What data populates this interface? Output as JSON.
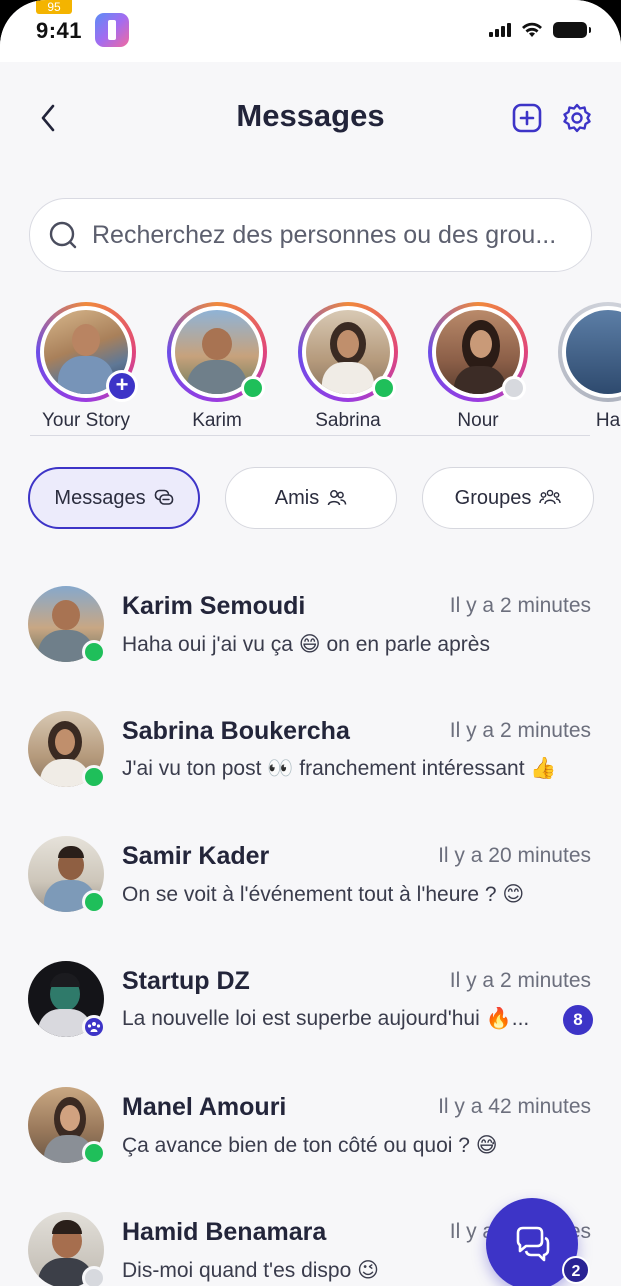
{
  "status_bar": {
    "battery_tag": "95",
    "time": "9:41"
  },
  "header": {
    "title": "Messages"
  },
  "search": {
    "placeholder": "Recherchez des personnes ou des grou..."
  },
  "stories": [
    {
      "name": "Your Story",
      "status": "add"
    },
    {
      "name": "Karim",
      "status": "online"
    },
    {
      "name": "Sabrina",
      "status": "online"
    },
    {
      "name": "Nour",
      "status": "offline"
    },
    {
      "name": "Ha",
      "status": "none"
    }
  ],
  "tabs": [
    {
      "label": "Messages",
      "icon": "chat-bubbles-icon",
      "active": true
    },
    {
      "label": "Amis",
      "icon": "users-icon",
      "active": false
    },
    {
      "label": "Groupes",
      "icon": "group-icon",
      "active": false
    }
  ],
  "conversations": [
    {
      "name": "Karim Semoudi",
      "time": "Il y a 2 minutes",
      "message": "Haha oui j'ai vu ça 😄 on en parle après",
      "status": "online"
    },
    {
      "name": "Sabrina Boukercha",
      "time": "Il y a 2 minutes",
      "message": "J'ai vu ton post 👀 franchement intéressant 👍",
      "status": "online"
    },
    {
      "name": "Samir Kader",
      "time": "Il y a 20 minutes",
      "message": "On se voit à l'événement tout à l'heure ? 😊",
      "status": "online"
    },
    {
      "name": "Startup DZ",
      "time": "Il y a 2 minutes",
      "message": "La nouvelle loi est superbe aujourd'hui 🔥...",
      "status": "group",
      "unread": "8"
    },
    {
      "name": "Manel Amouri",
      "time": "Il y a 42 minutes",
      "message": "Ça avance bien de ton côté ou quoi ? 😅",
      "status": "online"
    },
    {
      "name": "Hamid Benamara",
      "time": "Il y a 2 minutes",
      "message": "Dis-moi quand t'es dispo 😉",
      "status": "offline"
    }
  ],
  "fab": {
    "badge": "2",
    "icon": "chat-bubbles-icon"
  },
  "colors": {
    "accent": "#3d34c7",
    "online": "#1fbf5a",
    "background": "#f7f7f9"
  }
}
